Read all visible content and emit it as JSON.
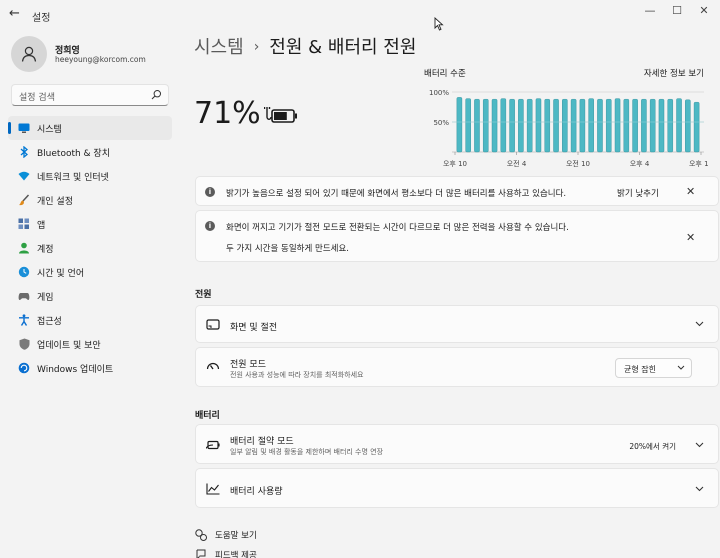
{
  "titlebar": {
    "back": "←",
    "title": "설정",
    "minimize": "—",
    "maximize": "☐",
    "close": "✕"
  },
  "user": {
    "name": "정희영",
    "email": "heeyoung@korcom.com"
  },
  "search": {
    "placeholder": "설정 검색"
  },
  "nav": [
    {
      "id": "system",
      "label": "시스템",
      "icon": "monitor-icon",
      "active": true,
      "color": "#0078d4"
    },
    {
      "id": "bluetooth",
      "label": "Bluetooth & 장치",
      "icon": "bluetooth-icon",
      "color": "#0078d4"
    },
    {
      "id": "network",
      "label": "네트워크 및 인터넷",
      "icon": "wifi-icon",
      "color": "#0a8fd8"
    },
    {
      "id": "personalization",
      "label": "개인 설정",
      "icon": "brush-icon",
      "color": "#d98a1a"
    },
    {
      "id": "apps",
      "label": "앱",
      "icon": "apps-icon",
      "color": "#4a6fa5"
    },
    {
      "id": "accounts",
      "label": "계정",
      "icon": "account-icon",
      "color": "#2ea043"
    },
    {
      "id": "time",
      "label": "시간 및 언어",
      "icon": "globe-clock-icon",
      "color": "#1a8fd8"
    },
    {
      "id": "gaming",
      "label": "게임",
      "icon": "gamepad-icon",
      "color": "#6b6b6b"
    },
    {
      "id": "accessibility",
      "label": "접근성",
      "icon": "accessibility-icon",
      "color": "#0a6fd0"
    },
    {
      "id": "privacy",
      "label": "업데이트 및 보안",
      "icon": "shield-icon",
      "color": "#7a7a7a"
    },
    {
      "id": "update",
      "label": "Windows 업데이트",
      "icon": "update-icon",
      "color": "#0a6fd0"
    }
  ],
  "breadcrumb": {
    "parent": "시스템",
    "separator": "›",
    "current": "전원 & 배터리 전원"
  },
  "battery": {
    "percent": "71%",
    "level": 0.71
  },
  "chart_data": {
    "type": "bar",
    "title": "배터리 수준",
    "link": "자세한 정보 보기",
    "y_ticks": [
      "100%",
      "50%"
    ],
    "ylim": [
      0,
      100
    ],
    "x_ticks": [
      "오후 10",
      "오전 4",
      "오전 10",
      "오후 4",
      "오후 10"
    ],
    "values": [
      91,
      89,
      88,
      88,
      88,
      89,
      88,
      88,
      88,
      89,
      88,
      88,
      88,
      88,
      88,
      89,
      88,
      88,
      89,
      88,
      88,
      88,
      88,
      88,
      88,
      89,
      87,
      83
    ],
    "bar_color": "#4db8c4",
    "grid": true
  },
  "notices": [
    {
      "text": "밝기가 높음으로 설정 되어 있기 때문에 화면에서 평소보다 더 많은 배터리를 사용하고 있습니다.",
      "action": "밝기 낮추기"
    },
    {
      "text": "화면이 꺼지고 기기가 절전 모드로 전환되는 시간이 다르므로 더 많은 전력을 사용할 수 있습니다.",
      "text2": "두 가지 시간을 동일하게 만드세요."
    }
  ],
  "power_section": {
    "heading": "전원",
    "screen_sleep": {
      "title": "화면 및 절전"
    },
    "power_mode": {
      "title": "전원 모드",
      "subtitle": "전원 사용과 성능에 따라 장치를 최적화하세요",
      "value": "균형 잡힌"
    }
  },
  "battery_section": {
    "heading": "배터리",
    "saver": {
      "title": "배터리 절약 모드",
      "subtitle": "일부 알림 및 배경 활동을 제한하며 배터리 수명 연장",
      "value": "20%에서 켜기"
    },
    "usage": {
      "title": "배터리 사용량"
    }
  },
  "footer": {
    "help": "도움말 보기",
    "feedback": "피드백 제공"
  }
}
